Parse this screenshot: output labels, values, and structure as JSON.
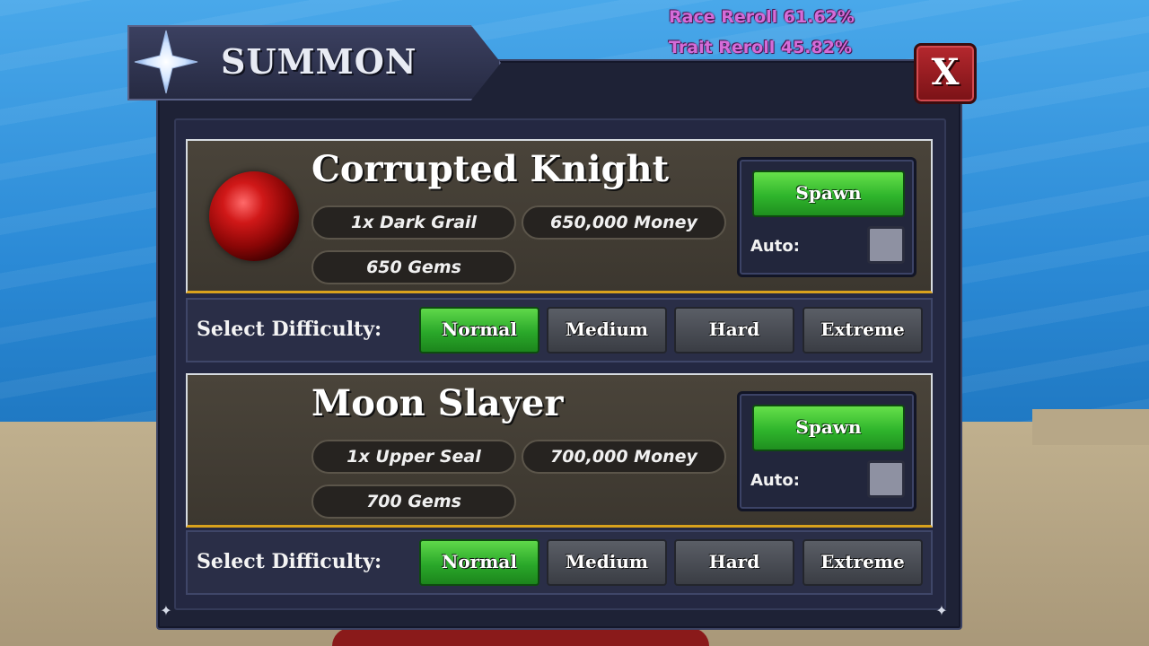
{
  "colors": {
    "panel_bg": "#1e2236",
    "card_border_accent": "#d8a11c",
    "spawn_green": "#2fb52c",
    "close_red": "#b5282e",
    "reroll_text": "#d46cd8"
  },
  "status": {
    "race_reroll": "Race Reroll 61.62%",
    "trait_reroll": "Trait Reroll 45.82%"
  },
  "header": {
    "title": "SUMMON",
    "icon": "star-icon"
  },
  "close_button": {
    "label": "X"
  },
  "bosses": [
    {
      "name": "Corrupted Knight",
      "icon": "red-orb-icon",
      "cost_item": "1x Dark Grail",
      "cost_money": "650,000 Money",
      "cost_gems": "650 Gems",
      "spawn_label": "Spawn",
      "auto_label": "Auto:",
      "auto_checked": false,
      "difficulty_label": "Select Difficulty:",
      "difficulties": [
        "Normal",
        "Medium",
        "Hard",
        "Extreme"
      ],
      "selected_difficulty": "Normal"
    },
    {
      "name": "Moon Slayer",
      "cost_item": "1x Upper Seal",
      "cost_money": "700,000 Money",
      "cost_gems": "700 Gems",
      "spawn_label": "Spawn",
      "auto_label": "Auto:",
      "auto_checked": false,
      "difficulty_label": "Select Difficulty:",
      "difficulties": [
        "Normal",
        "Medium",
        "Hard",
        "Extreme"
      ],
      "selected_difficulty": "Normal"
    }
  ]
}
